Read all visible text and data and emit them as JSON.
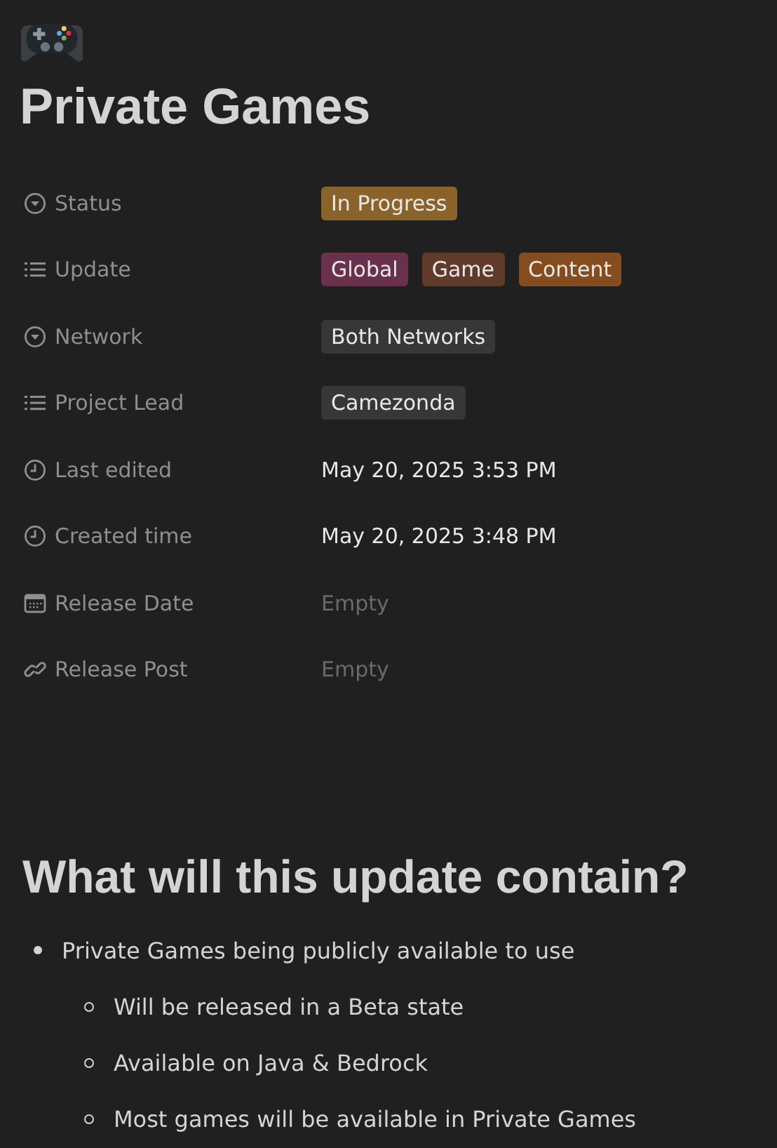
{
  "page": {
    "title": "Private Games"
  },
  "properties": [
    {
      "kind": "select",
      "label": "Status",
      "tags": [
        {
          "text": "In Progress",
          "color": "#89632a"
        }
      ]
    },
    {
      "kind": "multi_select",
      "label": "Update",
      "tags": [
        {
          "text": "Global",
          "color": "#69314c"
        },
        {
          "text": "Game",
          "color": "#603b2c"
        },
        {
          "text": "Content",
          "color": "#854c1d"
        }
      ]
    },
    {
      "kind": "select",
      "label": "Network",
      "tags": [
        {
          "text": "Both Networks",
          "color": "#373737"
        }
      ]
    },
    {
      "kind": "multi_select",
      "label": "Project Lead",
      "tags": [
        {
          "text": "Camezonda",
          "color": "#373737"
        }
      ]
    },
    {
      "kind": "last_edited_time",
      "label": "Last edited",
      "value": "May 20, 2025 3:53 PM",
      "empty": false
    },
    {
      "kind": "created_time",
      "label": "Created time",
      "value": "May 20, 2025 3:48 PM",
      "empty": false
    },
    {
      "kind": "date",
      "label": "Release Date",
      "value": "Empty",
      "empty": true
    },
    {
      "kind": "url",
      "label": "Release Post",
      "value": "Empty",
      "empty": true
    }
  ],
  "content": {
    "heading": "What will this update contain?",
    "bullets": [
      {
        "text": "Private Games being publicly available to use",
        "children": [
          {
            "text": "Will be released in a Beta state"
          },
          {
            "text": "Available on Java & Bedrock"
          },
          {
            "text": "Most games will be available in Private Games"
          }
        ]
      }
    ]
  }
}
